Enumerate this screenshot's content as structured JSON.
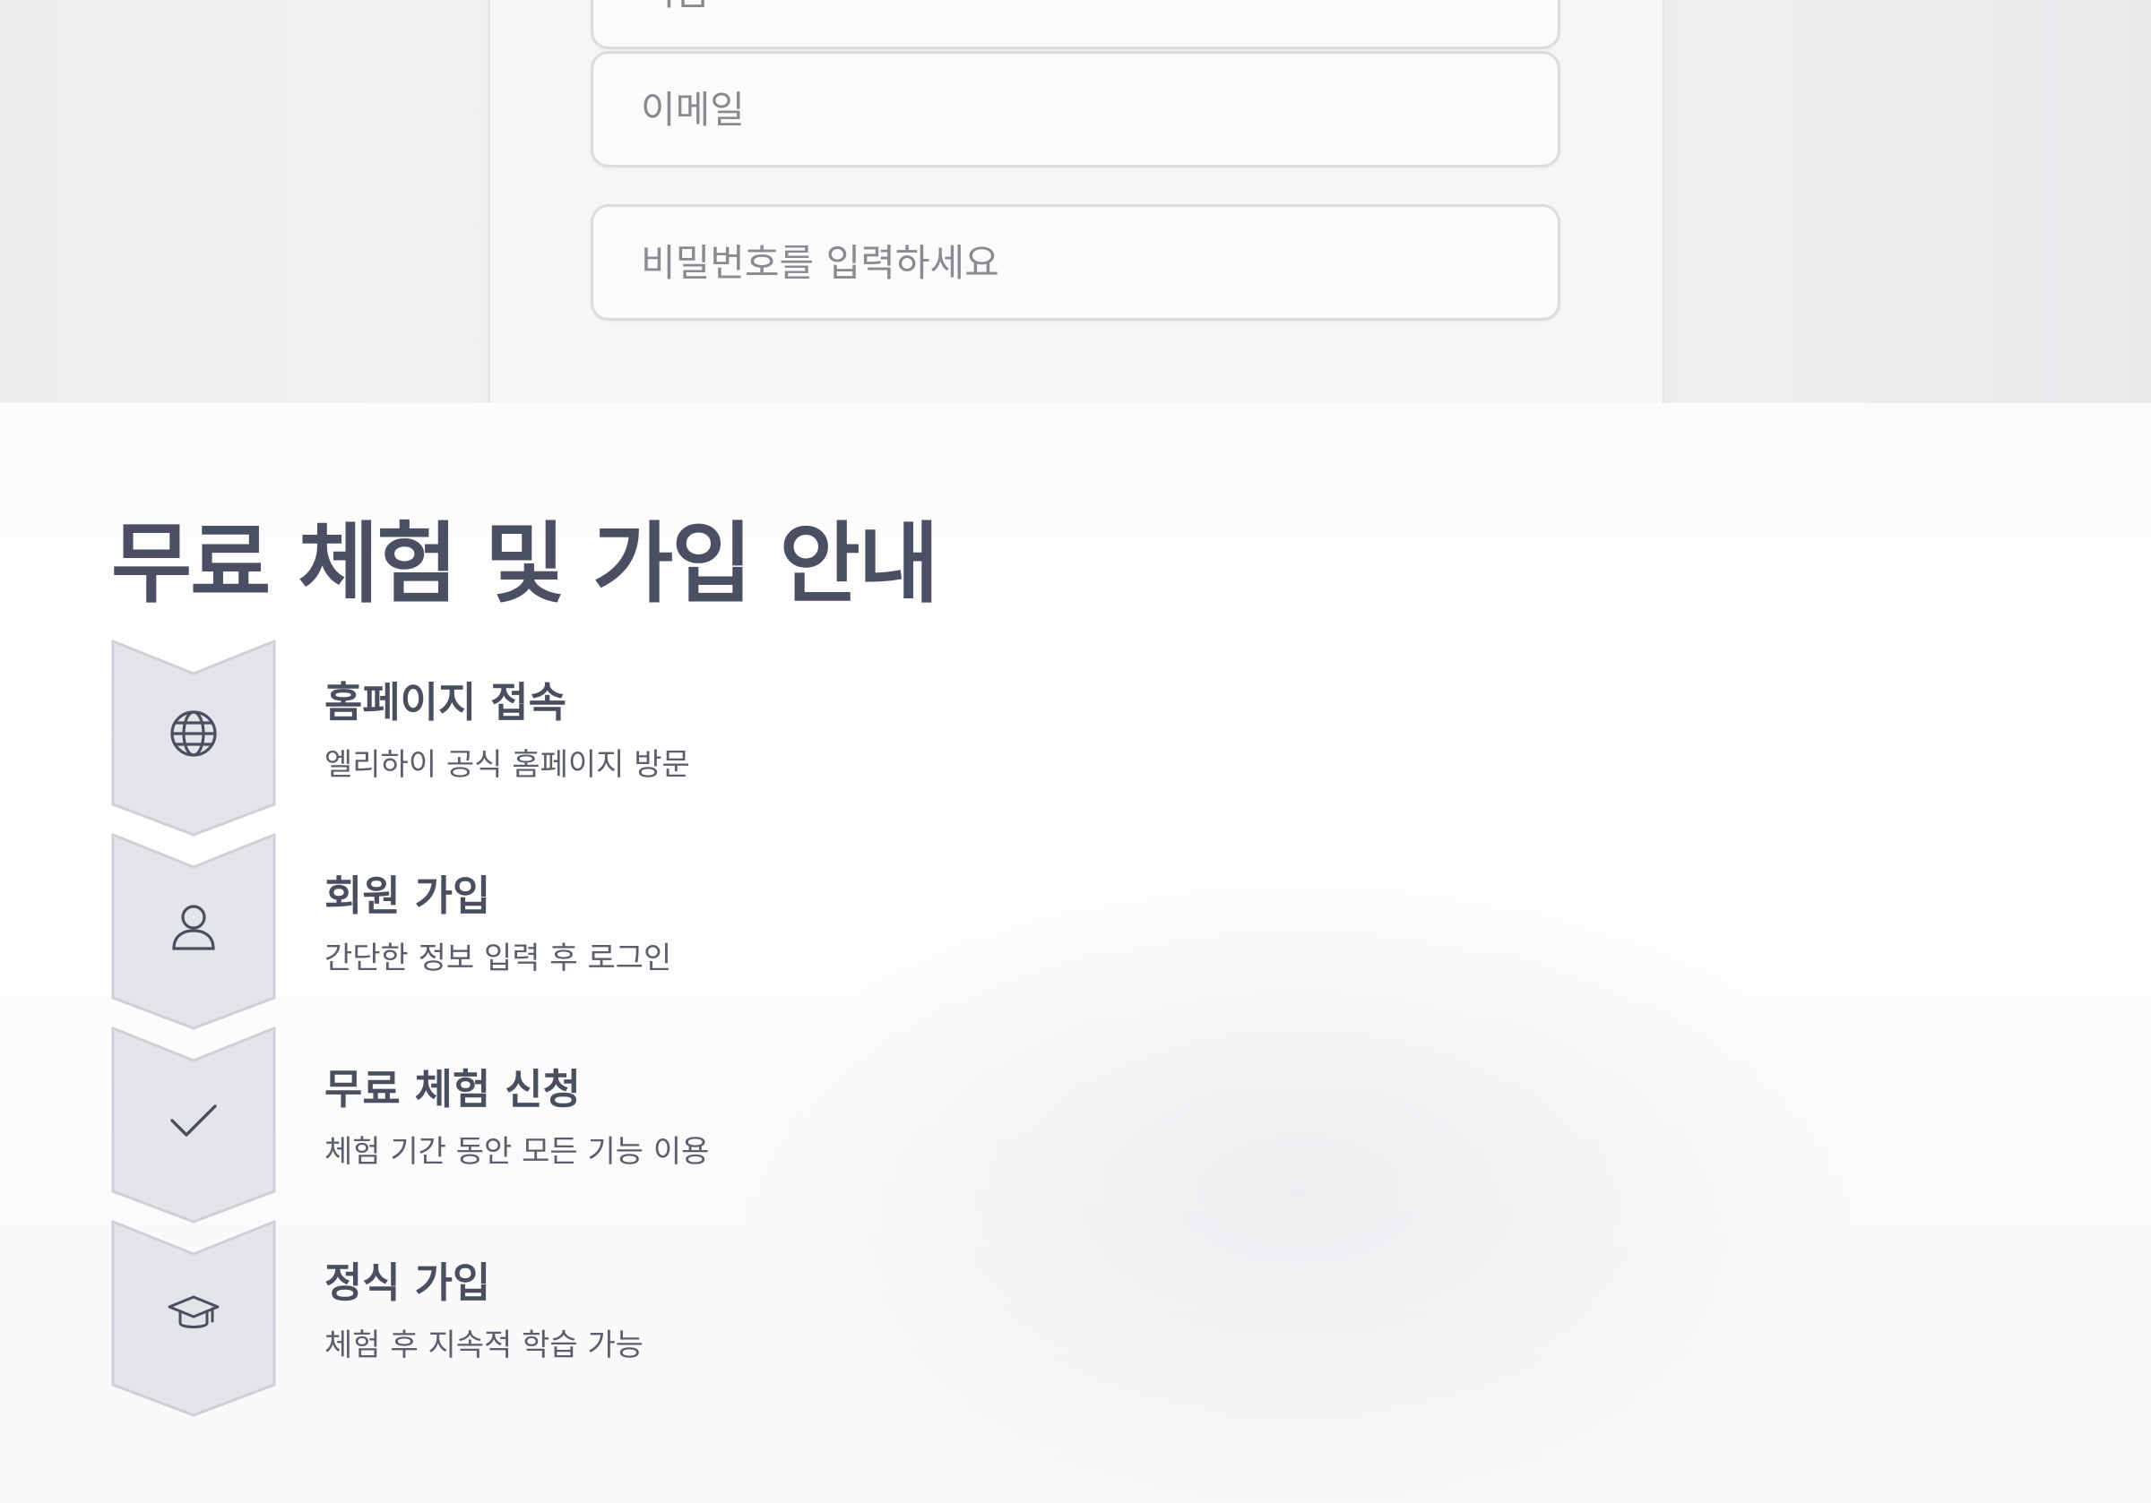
{
  "form": {
    "name_placeholder": "이름",
    "email_placeholder": "이메일",
    "password_placeholder": "비밀번호를 입력하세요"
  },
  "guide": {
    "title": "무료 체험 및 가입 안내",
    "steps": [
      {
        "icon": "globe-icon",
        "title": "홈페이지 접속",
        "desc": "엘리하이 공식 홈페이지 방문"
      },
      {
        "icon": "user-icon",
        "title": "회원 가입",
        "desc": "간단한 정보 입력 후 로그인"
      },
      {
        "icon": "check-icon",
        "title": "무료 체험 신청",
        "desc": "체험 기간 동안 모든 기능 이용"
      },
      {
        "icon": "graduation-cap-icon",
        "title": "정식 가입",
        "desc": "체험 후 지속적 학습 가능"
      }
    ]
  },
  "colors": {
    "heading": "#4a4f63",
    "chevron_fill": "#e4e5ea",
    "chevron_stroke": "#cfd0d6",
    "icon": "#4a4f60"
  }
}
